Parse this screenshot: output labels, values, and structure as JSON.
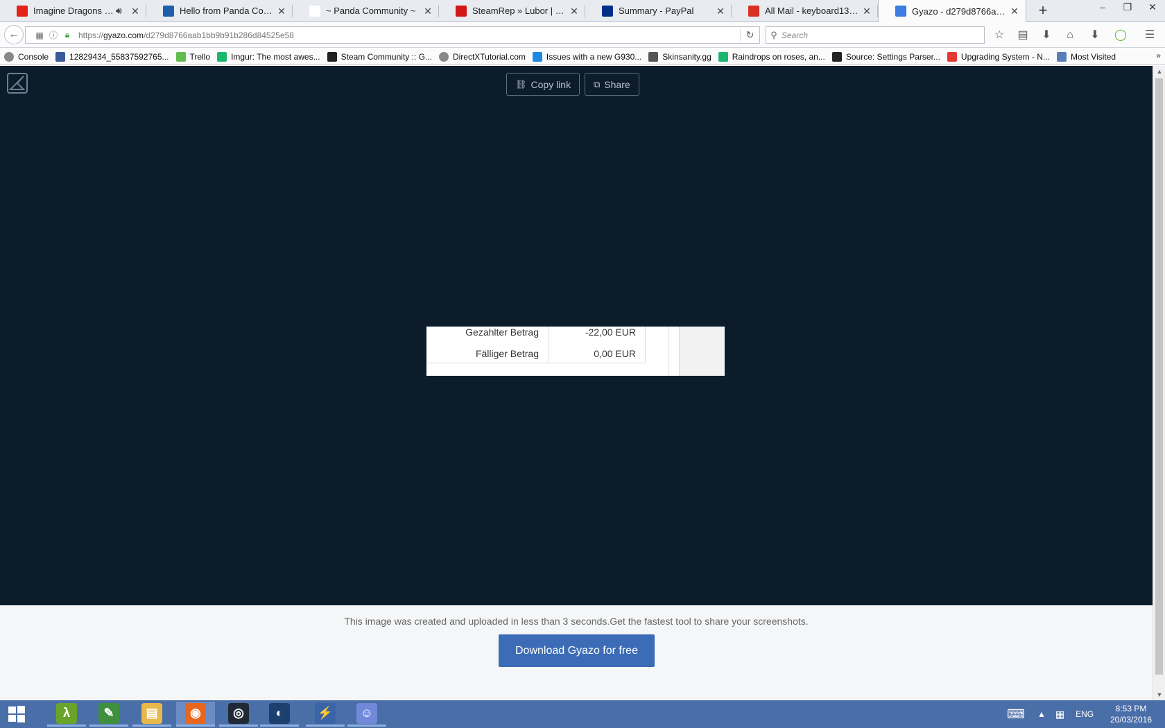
{
  "browser": {
    "tabs": [
      {
        "title": "Imagine Dragons - Ra...",
        "favicon": "youtube-icon",
        "color": "#e62117",
        "audio": true
      },
      {
        "title": "Hello from Panda Comm...",
        "favicon": "panda-community-icon",
        "color": "#1f5ea8"
      },
      {
        "title": "~ Panda Community ~",
        "favicon": "panda-face-icon",
        "color": "#ffffff"
      },
      {
        "title": "SteamRep » Lubor | 76561...",
        "favicon": "steamrep-icon",
        "color": "#d01616"
      },
      {
        "title": "Summary - PayPal",
        "favicon": "paypal-icon",
        "color": "#003087"
      },
      {
        "title": "All Mail - keyboard1333@...",
        "favicon": "gmail-icon",
        "color": "#d93025"
      },
      {
        "title": "Gyazo - d279d8766aab1bb...",
        "favicon": "gyazo-icon",
        "color": "#3b7de0",
        "active": true
      }
    ],
    "url_prefix": "https://",
    "url_host": "gyazo.com",
    "url_path": "/d279d8766aab1bb9b91b286d84525e58",
    "search_placeholder": "Search",
    "bookmarks": [
      {
        "label": "Console",
        "icon": "globe-icon",
        "color": "#888888"
      },
      {
        "label": "12829434_55837592765...",
        "icon": "facebook-icon",
        "color": "#3b5998"
      },
      {
        "label": "Trello",
        "icon": "trello-icon",
        "color": "#61bd4f"
      },
      {
        "label": "Imgur: The most awes...",
        "icon": "imgur-icon",
        "color": "#1bb76e"
      },
      {
        "label": "Steam Community :: G...",
        "icon": "steam-icon",
        "color": "#222222"
      },
      {
        "label": "DirectXTutorial.com",
        "icon": "globe-icon",
        "color": "#888888"
      },
      {
        "label": "Issues with a new G930...",
        "icon": "square-icon",
        "color": "#1e88e5"
      },
      {
        "label": "Skinsanity.gg",
        "icon": "page-icon",
        "color": "#555555"
      },
      {
        "label": "Raindrops on roses, an...",
        "icon": "imgur-icon",
        "color": "#1bb76e"
      },
      {
        "label": "Source: Settings Parser...",
        "icon": "github-icon",
        "color": "#222222"
      },
      {
        "label": "Upgrading System - N...",
        "icon": "t-icon",
        "color": "#e53935"
      },
      {
        "label": "Most Visited",
        "icon": "folder-icon",
        "color": "#5a7fb8"
      }
    ]
  },
  "gyazo": {
    "copy_link_label": "Copy link",
    "share_label": "Share",
    "screenshot_rows": [
      {
        "label": "Gezahlter Betrag",
        "value": "-22,00 EUR"
      },
      {
        "label": "Fälliger Betrag",
        "value": "0,00 EUR"
      }
    ],
    "promo_text": "This image was created and uploaded in less than 3 seconds.Get the fastest tool to share your screenshots.",
    "download_label": "Download Gyazo for free"
  },
  "taskbar": {
    "apps": [
      {
        "name": "lambda-app-icon",
        "glyph": "λ",
        "color": "#6aa329"
      },
      {
        "name": "notepad-app-icon",
        "glyph": "✎",
        "color": "#3e8f3e"
      },
      {
        "name": "file-explorer-icon",
        "glyph": "▤",
        "color": "#e8b84a"
      },
      {
        "name": "firefox-icon",
        "glyph": "◉",
        "color": "#e8661d",
        "active": true
      },
      {
        "name": "target-app-icon",
        "glyph": "◎",
        "color": "#1f2a36"
      },
      {
        "name": "steam-app-icon",
        "glyph": "◐",
        "color": "#1b3f6e"
      },
      {
        "name": "network-tool-icon",
        "glyph": "⚡",
        "color": "#3a63a8"
      },
      {
        "name": "discord-icon",
        "glyph": "☺",
        "color": "#7289da"
      }
    ],
    "language": "ENG",
    "time": "8:53 PM",
    "date": "20/03/2016"
  }
}
